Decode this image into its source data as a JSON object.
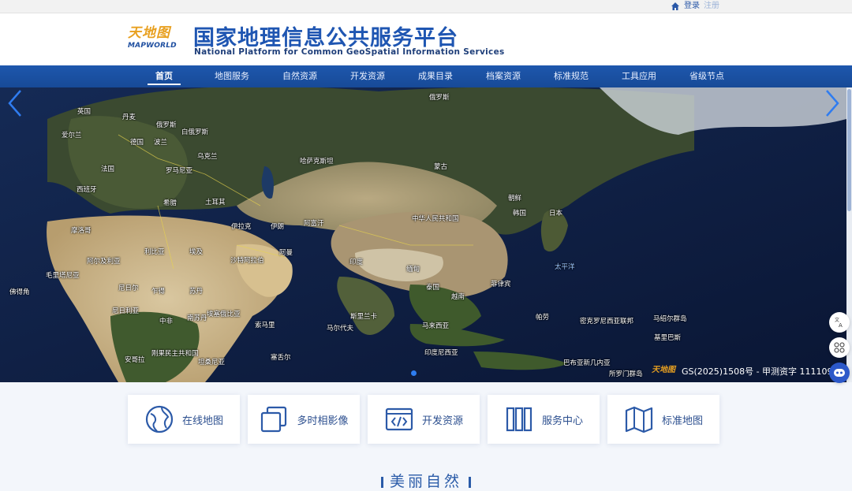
{
  "topbar": {
    "login": "登录",
    "register": "注册"
  },
  "header": {
    "logo_cn": "天地图",
    "logo_en": "MAPWORLD",
    "title_cn": "国家地理信息公共服务平台",
    "title_en": "National Platform for Common GeoSpatial Information Services"
  },
  "nav": {
    "items": [
      "首页",
      "地图服务",
      "自然资源",
      "开发资源",
      "成果目录",
      "档案资源",
      "标准规范",
      "工具应用",
      "省级节点"
    ],
    "active_index": 0
  },
  "banner": {
    "caption": "GS(2025)1508号 - 甲测资字 111109",
    "caption_logo": "天地图",
    "active_slide": 1,
    "labels": [
      "俄罗斯",
      "英国",
      "丹麦",
      "俄罗斯",
      "爱尔兰",
      "白俄罗斯",
      "德国",
      "波兰",
      "乌克兰",
      "法国",
      "罗马尼亚",
      "哈萨克斯坦",
      "蒙古",
      "西班牙",
      "希腊",
      "土耳其",
      "朝鲜",
      "韩国",
      "日本",
      "中华人民共和国",
      "摩洛哥",
      "伊拉克",
      "伊朗",
      "阿富汗",
      "阿尔及利亚",
      "利比亚",
      "埃及",
      "沙特阿拉伯",
      "阿曼",
      "印度",
      "缅甸",
      "泰国",
      "越南",
      "菲律宾",
      "太平洋",
      "毛里塔尼亚",
      "尼日尔",
      "乍得",
      "苏丹",
      "佛得角",
      "尼日利亚",
      "南苏丹",
      "埃塞俄比亚",
      "斯里兰卡",
      "马尔代夫",
      "马来西亚",
      "帕劳",
      "密克罗尼西亚联邦",
      "马绍尔群岛",
      "中非",
      "刚果民主共和国",
      "索马里",
      "基里巴斯",
      "安哥拉",
      "坦桑尼亚",
      "塞舌尔",
      "印度尼西亚",
      "巴布亚新几内亚",
      "所罗门群岛"
    ]
  },
  "cards": [
    {
      "label": "在线地图",
      "icon": "globe-icon"
    },
    {
      "label": "多时相影像",
      "icon": "layers-icon"
    },
    {
      "label": "开发资源",
      "icon": "code-icon"
    },
    {
      "label": "服务中心",
      "icon": "books-icon"
    },
    {
      "label": "标准地图",
      "icon": "folded-map-icon"
    }
  ],
  "section": {
    "title": "美丽自然"
  },
  "colors": {
    "brand_blue": "#1f56b2",
    "nav_blue": "#1b51a3",
    "accent_orange": "#e8a020"
  }
}
